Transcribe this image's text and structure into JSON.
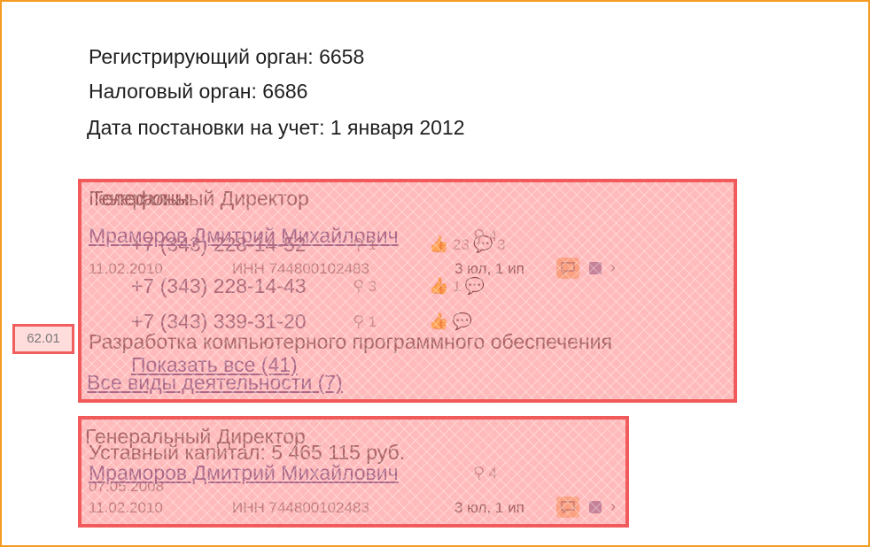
{
  "registration": {
    "registering_authority": "Регистрирующий орган: 6658",
    "tax_authority": "Налоговый орган: 6686",
    "registration_date": "Дата постановки на учет: 1 января 2012"
  },
  "block1": {
    "overlap_label": "Телефоны",
    "position_title": "Генеральный Директор",
    "person_name": "Мраморов Дмитрий Михайлович",
    "person_searches": "4",
    "date": "11.02.2010",
    "inn": "ИНН 744800102483",
    "companies": "3 юл, 1 ип",
    "phones": [
      {
        "number": "+7 (343) 228-14-52",
        "searches": "1",
        "likes": "23",
        "comments": "3"
      },
      {
        "number": "+7 (343) 228-14-43",
        "searches": "3",
        "likes": "1",
        "comments": ""
      },
      {
        "number": "+7 (343) 339-31-20",
        "searches": "1",
        "likes": "",
        "comments": ""
      }
    ],
    "okved_code": "62.01",
    "activity_main": "Разработка компьютерного программного обеспечения",
    "show_all": "Показать все (41)",
    "all_activities": "Все виды деятельности (7)"
  },
  "block2": {
    "position_title": "Генеральный Директор",
    "capital": "Уставный капитал: 5 465 115 руб.",
    "person_name": "Мраморов Дмитрий Михайлович",
    "person_searches": "4",
    "capital_date": "07.05.2008",
    "date": "11.02.2010",
    "inn": "ИНН 744800102483",
    "companies": "3 юл, 1 ип"
  },
  "icons": {
    "search": "magnifier-icon",
    "like": "thumbs-up-icon",
    "comment": "speech-bubble-icon",
    "chat": "chat-icon",
    "square": "square-icon",
    "chevron": "chevron-right-icon"
  },
  "colors": {
    "highlight_border": "#f05050",
    "highlight_fill": "#ff7878",
    "frame": "#f59a23",
    "chat_bg": "#f7c98a"
  }
}
